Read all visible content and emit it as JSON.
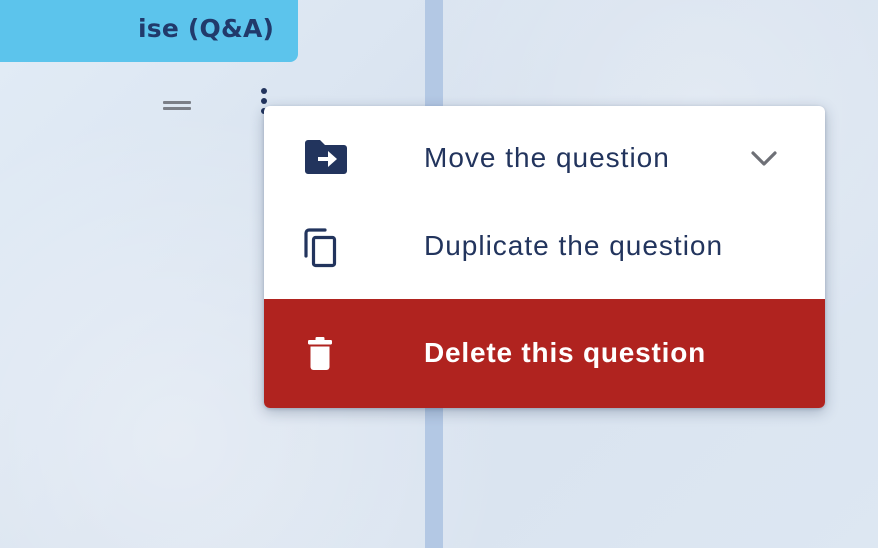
{
  "section_tab": {
    "label": "ise (Q&A)"
  },
  "question_toolbar": {
    "drag_icon": "drag-handle-icon",
    "more_icon": "more-vertical-icon"
  },
  "context_menu": {
    "items": [
      {
        "label": "Move the question",
        "icon": "folder-move-icon",
        "trailing_icon": "chevron-down-icon"
      },
      {
        "label": "Duplicate the question",
        "icon": "copy-icon"
      },
      {
        "label": "Delete this question",
        "icon": "trash-icon",
        "style": "danger"
      }
    ]
  },
  "colors": {
    "tab_background": "#5cc4ec",
    "text_primary": "#22345d",
    "danger_background": "#b0231f",
    "danger_text": "#ffffff",
    "divider": "#b3c8e4"
  }
}
